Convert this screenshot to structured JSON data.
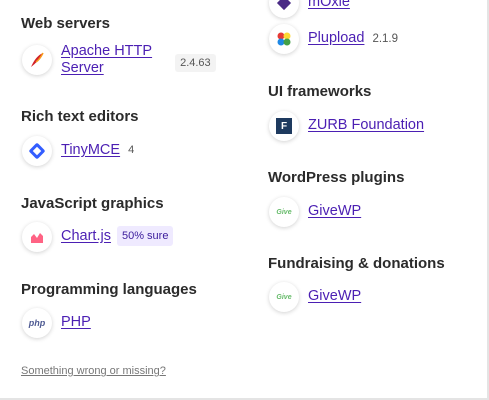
{
  "left": {
    "web_servers": {
      "title": "Web servers",
      "name_line1": "Apache HTTP",
      "name_line2": "Server",
      "version": "2.4.63"
    },
    "rich_text": {
      "title": "Rich text editors",
      "name": "TinyMCE",
      "version": "4"
    },
    "js_graphics": {
      "title": "JavaScript graphics",
      "name": "Chart.js",
      "confidence": "50% sure"
    },
    "prog_lang": {
      "title": "Programming languages",
      "name": "PHP",
      "icon_text": "php"
    }
  },
  "right": {
    "mosaic": {
      "name": "mOxie"
    },
    "plupload": {
      "name": "Plupload",
      "version": "2.1.9"
    },
    "ui_frameworks": {
      "title": "UI frameworks",
      "name": "ZURB Foundation",
      "icon_text": "F"
    },
    "wordpress_plugins": {
      "title": "WordPress plugins",
      "name": "GiveWP",
      "icon_text": "Give"
    },
    "fundraising": {
      "title": "Fundraising & donations",
      "name": "GiveWP",
      "icon_text": "Give"
    }
  },
  "footer": {
    "link": "Something wrong or missing?"
  },
  "colors": {
    "link": "#4b1fb3",
    "badge_bg": "#efeaff",
    "give_green": "#66bb6a"
  }
}
